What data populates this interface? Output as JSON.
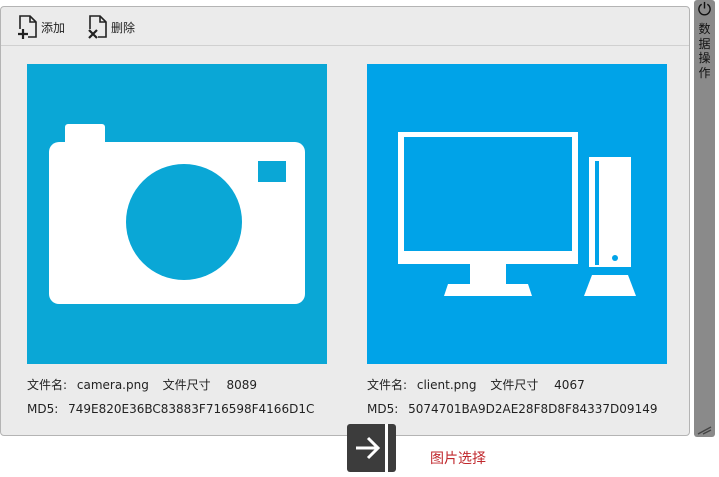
{
  "toolbar": {
    "add_label": "添加",
    "delete_label": "删除"
  },
  "images": [
    {
      "icon": "camera-icon",
      "filename_label": "文件名:",
      "filename": "camera.png",
      "size_label": "文件尺寸",
      "size": "8089",
      "md5_label": "MD5:",
      "md5": "749E820E36BC83883F716598F4166D1C"
    },
    {
      "icon": "computer-icon",
      "filename_label": "文件名:",
      "filename": "client.png",
      "size_label": "文件尺寸",
      "size": "4067",
      "md5_label": "MD5:",
      "md5": "5074701BA9D2AE28F8D8F84337D09149"
    }
  ],
  "sidebar": {
    "label": "数据操作",
    "icon": "power-icon"
  },
  "footer": {
    "toggle_icon": "arrow-right-icon",
    "pick_label": "图片选择"
  },
  "colors": {
    "camera_tile": "#0aa7d6",
    "computer_tile": "#00a3e8",
    "accent_text": "#c0282d",
    "sidebar": "#8a8a8a"
  }
}
